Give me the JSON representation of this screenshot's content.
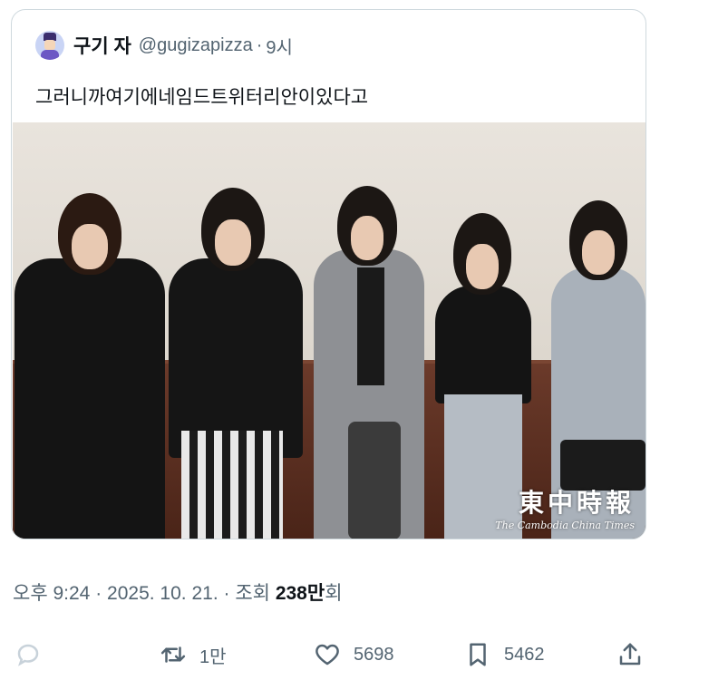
{
  "quoted_tweet": {
    "display_name": "구기 자",
    "handle": "@gugizapizza",
    "separator": "·",
    "time": "9시",
    "text": "그러니까여기에네임드트위터리안이있다고",
    "media": {
      "watermark_cjk": "東中時報",
      "watermark_en": "The Cambodia China Times"
    }
  },
  "meta": {
    "time": "오후 9:24",
    "sep1": "·",
    "date": "2025. 10. 21.",
    "sep2": "·",
    "views_label": "조회",
    "views_count": "238만",
    "views_suffix": "회"
  },
  "actions": {
    "reply_icon": "reply-icon",
    "retweet_icon": "retweet-icon",
    "retweet_count": "1만",
    "like_icon": "heart-icon",
    "like_count": "5698",
    "bookmark_icon": "bookmark-icon",
    "bookmark_count": "5462",
    "share_icon": "share-icon"
  },
  "colors": {
    "text_primary": "#0f1419",
    "text_secondary": "#536471",
    "border": "#cfd9de",
    "reply_icon_faded": "#c8d2da"
  }
}
